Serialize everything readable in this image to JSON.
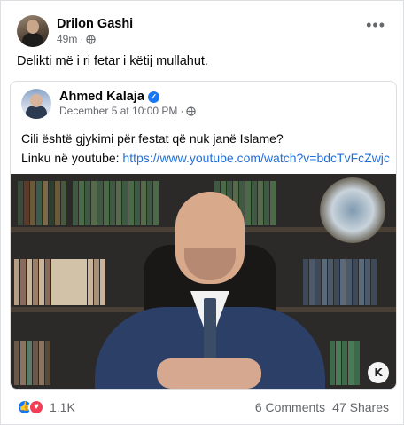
{
  "post": {
    "author": "Drilon Gashi",
    "time": "49m",
    "separator": "·",
    "caption": "Delikti më i ri fetar i këtij mullahut.",
    "more": "•••"
  },
  "shared_post": {
    "author": "Ahmed Kalaja",
    "time": "December 5 at 10:00 PM",
    "separator": "·",
    "line1": "Cili është gjykimi për festat që nuk janë Islame?",
    "line2_prefix": "Linku në youtube: ",
    "link": "https://www.youtube.com/watch?v=bdcTvFcZwjc",
    "video_logo": "K"
  },
  "footer": {
    "reaction_count": "1.1K",
    "comments": "6 Comments",
    "shares": "47 Shares"
  },
  "colors": {
    "link": "#216fdb",
    "like": "#1877f2",
    "love": "#f33e58",
    "muted": "#65676b"
  }
}
